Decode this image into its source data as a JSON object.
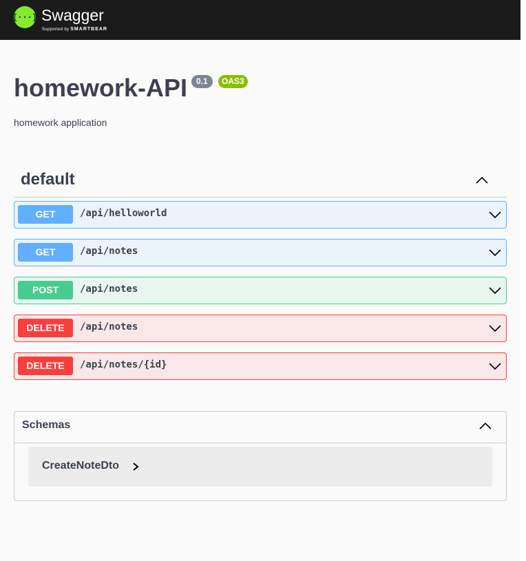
{
  "header": {
    "brand": "Swagger",
    "tagline_prefix": "Supported by",
    "tagline_brand": "SMARTBEAR",
    "logo_glyph": "{···}"
  },
  "info": {
    "title": "homework-API",
    "version": "0.1",
    "spec": "OAS3",
    "description": "homework application"
  },
  "tag": {
    "name": "default"
  },
  "operations": [
    {
      "method": "GET",
      "path": "/api/helloworld"
    },
    {
      "method": "GET",
      "path": "/api/notes"
    },
    {
      "method": "POST",
      "path": "/api/notes"
    },
    {
      "method": "DELETE",
      "path": "/api/notes"
    },
    {
      "method": "DELETE",
      "path": "/api/notes/{id}"
    }
  ],
  "schemas": {
    "title": "Schemas",
    "models": [
      "CreateNoteDto"
    ]
  },
  "colors": {
    "get": "#61affe",
    "post": "#49cc90",
    "delete": "#f93e3e",
    "topbar": "#1b1b1b",
    "logo": "#85ea2d",
    "oas_badge": "#89bf04",
    "version_badge": "#7d8492"
  }
}
